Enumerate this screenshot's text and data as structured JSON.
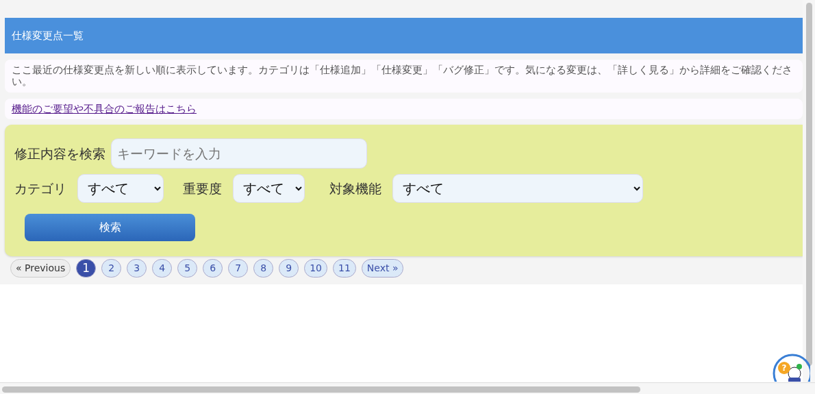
{
  "header": {
    "title": "仕様変更点一覧"
  },
  "description": "ここ最近の仕様変更点を新しい順に表示しています。カテゴリは「仕様追加」「仕様変更」「バグ修正」です。気になる変更は、「詳しく見る」から詳細をご確認ください。",
  "feedback_link": "機能のご要望や不具合のご報告はこちら",
  "search": {
    "label": "修正内容を検索",
    "placeholder": "キーワードを入力",
    "filters": [
      {
        "label": "カテゴリ",
        "value": "すべて"
      },
      {
        "label": "重要度",
        "value": "すべて"
      },
      {
        "label": "対象機能",
        "value": "すべて"
      }
    ],
    "button": "検索"
  },
  "pagination": [
    {
      "label": "« Previous",
      "kind": "nav",
      "selected": false
    },
    {
      "label": "1",
      "kind": "page",
      "selected": true
    },
    {
      "label": "2",
      "kind": "page",
      "selected": false
    },
    {
      "label": "3",
      "kind": "page",
      "selected": false
    },
    {
      "label": "4",
      "kind": "page",
      "selected": false
    },
    {
      "label": "5",
      "kind": "page",
      "selected": false
    },
    {
      "label": "6",
      "kind": "page",
      "selected": false
    },
    {
      "label": "7",
      "kind": "page",
      "selected": false
    },
    {
      "label": "8",
      "kind": "page",
      "selected": false
    },
    {
      "label": "9",
      "kind": "page",
      "selected": false
    },
    {
      "label": "10",
      "kind": "page",
      "selected": false
    },
    {
      "label": "11",
      "kind": "page",
      "selected": false
    },
    {
      "label": "Next »",
      "kind": "next",
      "selected": false
    }
  ],
  "help_widget": {
    "badge": "?"
  }
}
